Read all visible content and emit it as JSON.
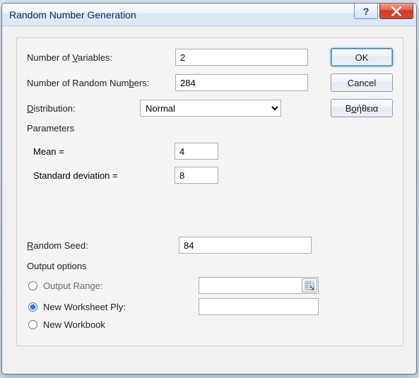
{
  "window": {
    "title": "Random Number Generation",
    "help_tooltip": "?",
    "close_tooltip": "Close"
  },
  "fields": {
    "num_variables_label_pre": "Number of ",
    "num_variables_label_ul": "V",
    "num_variables_label_post": "ariables:",
    "num_variables_value": "2",
    "num_random_label_pre": "Number of Random Num",
    "num_random_label_ul": "b",
    "num_random_label_post": "ers:",
    "num_random_value": "284",
    "distribution_label_ul": "D",
    "distribution_label_post": "istribution:",
    "distribution_value": "Normal",
    "distribution_options": [
      "Normal"
    ]
  },
  "parameters": {
    "group_label": "Parameters",
    "mean_label_pre": "M",
    "mean_label_ul": "e",
    "mean_label_post": "an =",
    "mean_value": "4",
    "stddev_label_ul": "S",
    "stddev_label_post": "tandard deviation =",
    "stddev_value": "8"
  },
  "seed": {
    "label_ul": "R",
    "label_post": "andom Seed:",
    "value": "84"
  },
  "output": {
    "group_label": "Output options",
    "opt_range_label_ul": "O",
    "opt_range_label_post": "utput Range:",
    "opt_range_value": "",
    "opt_ply_label_pre": "New Worksheet ",
    "opt_ply_label_ul": "P",
    "opt_ply_label_post": "ly:",
    "opt_ply_value": "",
    "opt_workbook_label_pre": "New ",
    "opt_workbook_label_ul": "W",
    "opt_workbook_label_post": "orkbook",
    "selected": "ply"
  },
  "buttons": {
    "ok": "OK",
    "cancel": "Cancel",
    "help_pre": "Β",
    "help_ul": "ο",
    "help_post": "ήθεια"
  }
}
